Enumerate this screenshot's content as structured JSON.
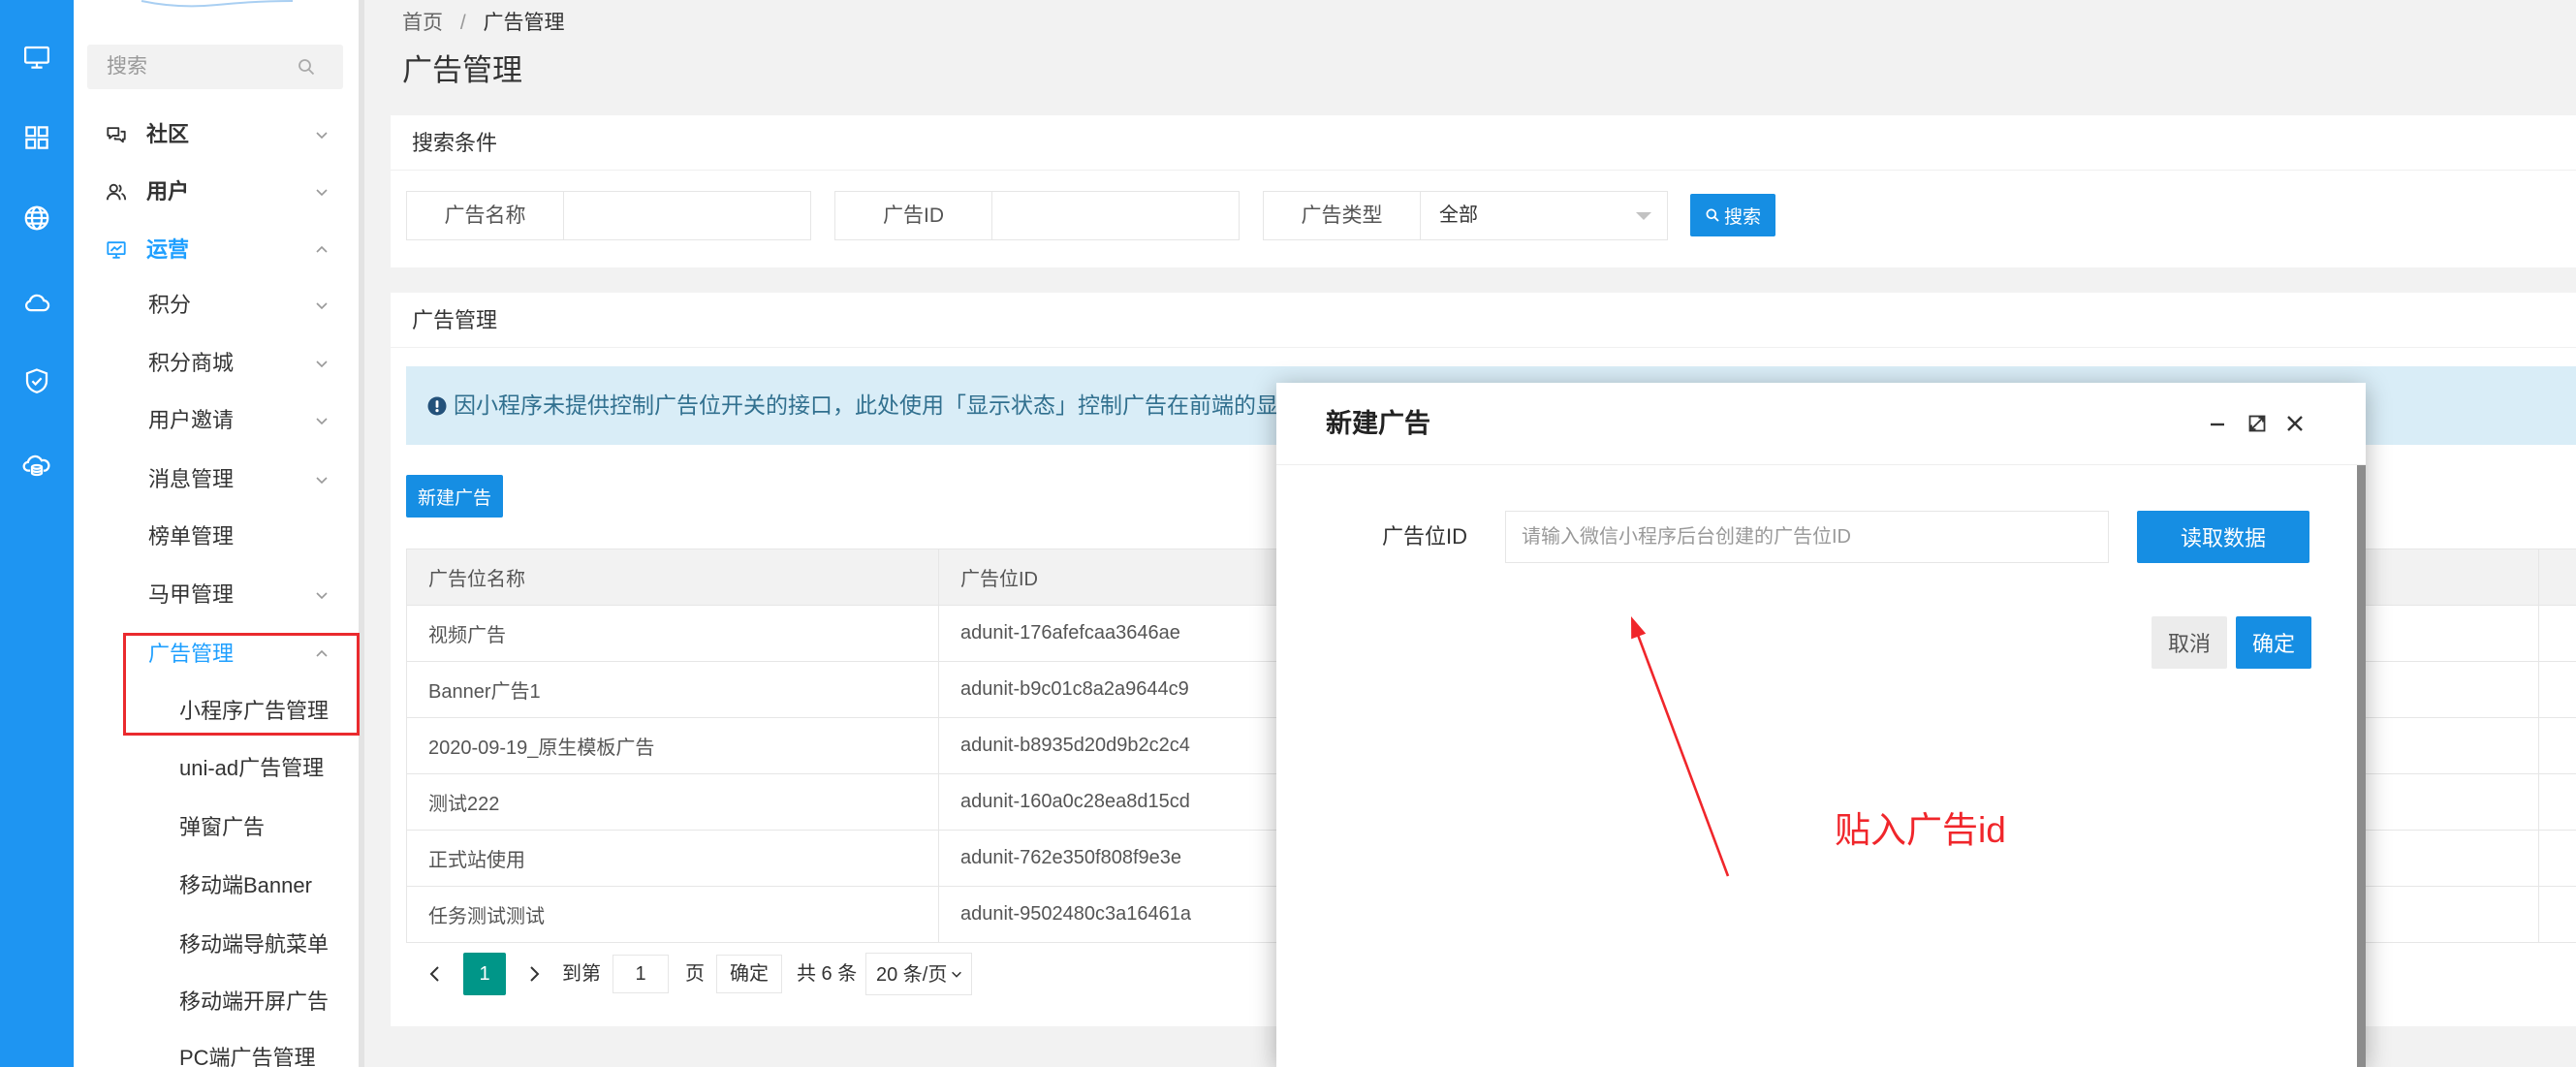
{
  "colors": {
    "rail_bg": "#1e95f2",
    "primary": "#168ee3",
    "active_menu": "#1e9fff",
    "current_page": "#009688",
    "notice_bg": "#d9edf7",
    "annotation": "#f0262b"
  },
  "rail": {
    "icons": [
      "monitor-icon",
      "grid-icon",
      "globe-icon",
      "cloud-icon",
      "shield-check-icon",
      "cloud-database-icon"
    ]
  },
  "sidebar": {
    "search_placeholder": "搜索",
    "menu": [
      {
        "label": "社区",
        "icon": "chat-icon",
        "chevron": "chevron-down-icon"
      },
      {
        "label": "用户",
        "icon": "users-icon",
        "chevron": "chevron-down-icon"
      },
      {
        "label": "运营",
        "icon": "chart-monitor-icon",
        "chevron": "chevron-up-icon",
        "active": true
      }
    ],
    "ops_items": [
      {
        "label": "积分",
        "chevron": "chevron-down-icon"
      },
      {
        "label": "积分商城",
        "chevron": "chevron-down-icon"
      },
      {
        "label": "用户邀请",
        "chevron": "chevron-down-icon"
      },
      {
        "label": "消息管理",
        "chevron": "chevron-down-icon"
      },
      {
        "label": "榜单管理"
      },
      {
        "label": "马甲管理",
        "chevron": "chevron-down-icon"
      },
      {
        "label": "广告管理",
        "chevron": "chevron-up-icon",
        "active": true
      }
    ],
    "ad_items": [
      {
        "label": "小程序广告管理"
      },
      {
        "label": "uni-ad广告管理"
      },
      {
        "label": "弹窗广告"
      },
      {
        "label": "移动端Banner"
      },
      {
        "label": "移动端导航菜单"
      },
      {
        "label": "移动端开屏广告"
      },
      {
        "label": "PC端广告管理"
      }
    ]
  },
  "breadcrumb": {
    "home": "首页",
    "separator": "/",
    "current": "广告管理"
  },
  "page_title": "广告管理",
  "search_card": {
    "title": "搜索条件",
    "fields": [
      {
        "label": "广告名称",
        "value": ""
      },
      {
        "label": "广告ID",
        "value": ""
      },
      {
        "label": "广告类型",
        "value": "全部"
      }
    ],
    "search_button": "搜索"
  },
  "list_card": {
    "title": "广告管理",
    "notice": "因小程序未提供控制广告位开关的接口，此处使用「显示状态」控制广告在前端的显示与隐藏",
    "new_button": "新建广告",
    "table": {
      "columns": [
        "广告位名称",
        "广告位ID"
      ],
      "rows": [
        [
          "视频广告",
          "adunit-176afefcaa3646ae"
        ],
        [
          "Banner广告1",
          "adunit-b9c01c8a2a9644c9"
        ],
        [
          "2020-09-19_原生模板广告",
          "adunit-b8935d20d9b2c2c4"
        ],
        [
          "测试222",
          "adunit-160a0c28ea8d15cd"
        ],
        [
          "正式站使用",
          "adunit-762e350f808f9e3e"
        ],
        [
          "任务测试测试",
          "adunit-9502480c3a16461a"
        ]
      ]
    },
    "pagination": {
      "current_page": "1",
      "goto_label": "到第",
      "goto_value": "1",
      "page_unit": "页",
      "confirm": "确定",
      "total": "共 6 条",
      "page_size": "20 条/页"
    }
  },
  "modal": {
    "title": "新建广告",
    "field_label": "广告位ID",
    "field_placeholder": "请输入微信小程序后台创建的广告位ID",
    "read_button": "读取数据",
    "cancel_button": "取消",
    "confirm_button": "确定",
    "window_controls": [
      "minimize-icon",
      "maximize-icon",
      "close-icon"
    ]
  },
  "annotation": {
    "text": "贴入广告id"
  }
}
